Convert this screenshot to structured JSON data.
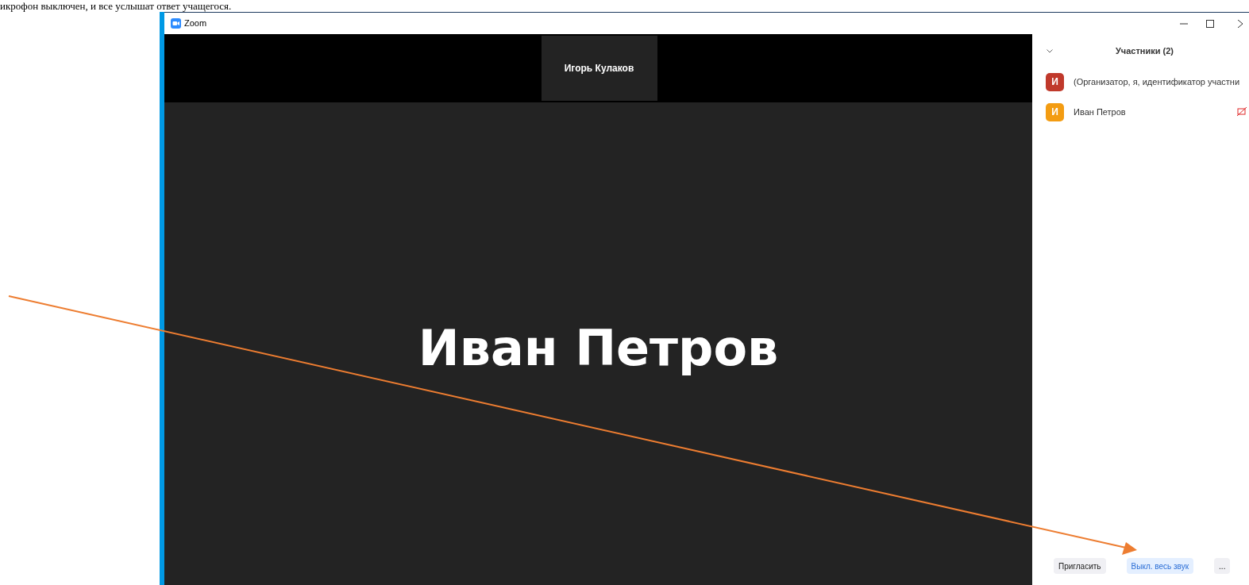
{
  "document_text": "икрофон выключен, и все услышат ответ учащегося.",
  "window": {
    "title": "Zoom"
  },
  "thumbnail": {
    "name": "Игорь Кулаков"
  },
  "active_speaker": {
    "name": "Иван Петров"
  },
  "participants_panel": {
    "title": "Участники (2)",
    "participants": [
      {
        "initial": "И",
        "name": "(Организатор, я, идентификатор участни",
        "color": "#c0392b",
        "muted_icon": false
      },
      {
        "initial": "И",
        "name": "Иван Петров",
        "color": "#f39c12",
        "muted_icon": true
      }
    ],
    "buttons": [
      {
        "label": "Пригласить",
        "kind": "secondary"
      },
      {
        "label": "Выкл. весь звук",
        "kind": "primary"
      },
      {
        "label": "...",
        "kind": "secondary"
      }
    ]
  }
}
